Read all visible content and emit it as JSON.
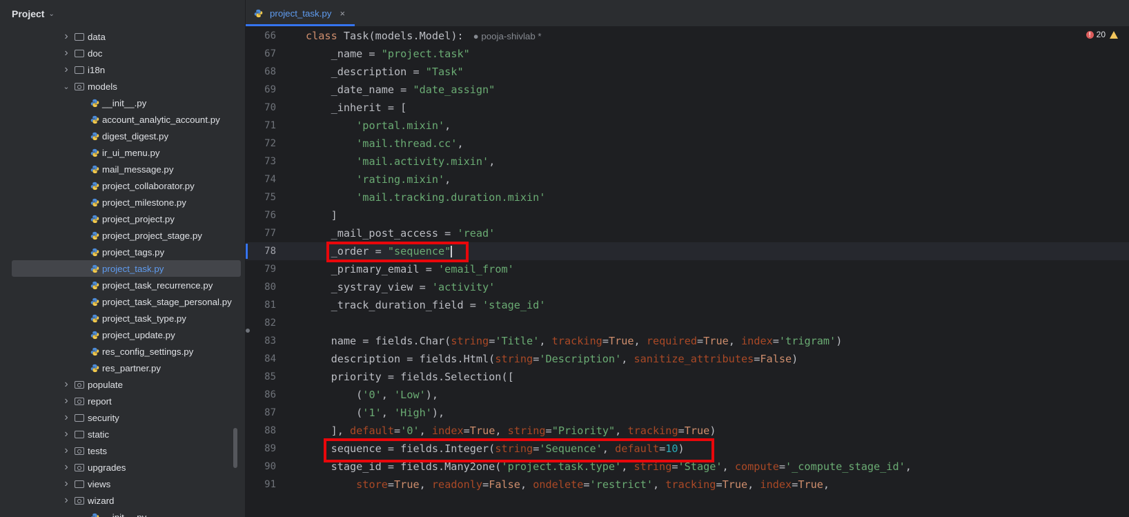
{
  "sidebar": {
    "title": "Project",
    "items": [
      {
        "label": "data",
        "type": "folder"
      },
      {
        "label": "doc",
        "type": "folder"
      },
      {
        "label": "i18n",
        "type": "folder"
      },
      {
        "label": "models",
        "type": "package",
        "expanded": true
      },
      {
        "label": "__init__.py",
        "type": "py"
      },
      {
        "label": "account_analytic_account.py",
        "type": "py"
      },
      {
        "label": "digest_digest.py",
        "type": "py"
      },
      {
        "label": "ir_ui_menu.py",
        "type": "py"
      },
      {
        "label": "mail_message.py",
        "type": "py"
      },
      {
        "label": "project_collaborator.py",
        "type": "py"
      },
      {
        "label": "project_milestone.py",
        "type": "py"
      },
      {
        "label": "project_project.py",
        "type": "py"
      },
      {
        "label": "project_project_stage.py",
        "type": "py"
      },
      {
        "label": "project_tags.py",
        "type": "py"
      },
      {
        "label": "project_task.py",
        "type": "py",
        "selected": true
      },
      {
        "label": "project_task_recurrence.py",
        "type": "py"
      },
      {
        "label": "project_task_stage_personal.py",
        "type": "py"
      },
      {
        "label": "project_task_type.py",
        "type": "py"
      },
      {
        "label": "project_update.py",
        "type": "py"
      },
      {
        "label": "res_config_settings.py",
        "type": "py"
      },
      {
        "label": "res_partner.py",
        "type": "py"
      },
      {
        "label": "populate",
        "type": "package"
      },
      {
        "label": "report",
        "type": "package"
      },
      {
        "label": "security",
        "type": "folder"
      },
      {
        "label": "static",
        "type": "folder"
      },
      {
        "label": "tests",
        "type": "package"
      },
      {
        "label": "upgrades",
        "type": "package"
      },
      {
        "label": "views",
        "type": "folder"
      },
      {
        "label": "wizard",
        "type": "package"
      },
      {
        "label": "__init__.py",
        "type": "py"
      }
    ]
  },
  "tab": {
    "label": "project_task.py",
    "close": "×"
  },
  "status": {
    "errors": "20"
  },
  "author": "pooja-shivlab *",
  "colors": {
    "accent": "#3574f0",
    "highlight": "#e8070b",
    "keyword": "#cf8e6d",
    "string": "#6aab73",
    "number": "#2aacb8",
    "param": "#aa4926"
  },
  "lines": [
    {
      "n": "66",
      "tokens": [
        [
          "kw",
          "class "
        ],
        [
          "",
          "Task(models.Model):"
        ]
      ]
    },
    {
      "n": "67",
      "tokens": [
        [
          "",
          "    _name = "
        ],
        [
          "str",
          "\"project.task\""
        ]
      ]
    },
    {
      "n": "68",
      "tokens": [
        [
          "",
          "    _description = "
        ],
        [
          "str",
          "\"Task\""
        ]
      ]
    },
    {
      "n": "69",
      "tokens": [
        [
          "",
          "    _date_name = "
        ],
        [
          "str",
          "\"date_assign\""
        ]
      ]
    },
    {
      "n": "70",
      "tokens": [
        [
          "",
          "    _inherit = ["
        ]
      ]
    },
    {
      "n": "71",
      "tokens": [
        [
          "",
          "        "
        ],
        [
          "str",
          "'portal.mixin'"
        ],
        [
          "",
          ","
        ]
      ]
    },
    {
      "n": "72",
      "tokens": [
        [
          "",
          "        "
        ],
        [
          "str",
          "'mail.thread.cc'"
        ],
        [
          "",
          ","
        ]
      ]
    },
    {
      "n": "73",
      "tokens": [
        [
          "",
          "        "
        ],
        [
          "str",
          "'mail.activity.mixin'"
        ],
        [
          "",
          ","
        ]
      ]
    },
    {
      "n": "74",
      "tokens": [
        [
          "",
          "        "
        ],
        [
          "str",
          "'rating.mixin'"
        ],
        [
          "",
          ","
        ]
      ]
    },
    {
      "n": "75",
      "tokens": [
        [
          "",
          "        "
        ],
        [
          "str",
          "'mail.tracking.duration.mixin'"
        ]
      ]
    },
    {
      "n": "76",
      "tokens": [
        [
          "",
          "    ]"
        ]
      ]
    },
    {
      "n": "77",
      "tokens": [
        [
          "",
          "    _mail_post_access = "
        ],
        [
          "str",
          "'read'"
        ]
      ]
    },
    {
      "n": "78",
      "current": true,
      "tokens": [
        [
          "",
          "    _order = "
        ],
        [
          "str",
          "\"sequence\""
        ]
      ]
    },
    {
      "n": "79",
      "tokens": [
        [
          "",
          "    _primary_email = "
        ],
        [
          "str",
          "'email_from'"
        ]
      ]
    },
    {
      "n": "80",
      "tokens": [
        [
          "",
          "    _systray_view = "
        ],
        [
          "str",
          "'activity'"
        ]
      ]
    },
    {
      "n": "81",
      "tokens": [
        [
          "",
          "    _track_duration_field = "
        ],
        [
          "str",
          "'stage_id'"
        ]
      ]
    },
    {
      "n": "82",
      "tokens": []
    },
    {
      "n": "83",
      "tokens": [
        [
          "",
          "    name = fields.Char("
        ],
        [
          "param",
          "string"
        ],
        [
          "",
          "="
        ],
        [
          "str",
          "'Title'"
        ],
        [
          "",
          ", "
        ],
        [
          "param",
          "tracking"
        ],
        [
          "",
          "="
        ],
        [
          "kw",
          "True"
        ],
        [
          "",
          ", "
        ],
        [
          "param",
          "required"
        ],
        [
          "",
          "="
        ],
        [
          "kw",
          "True"
        ],
        [
          "",
          ", "
        ],
        [
          "param",
          "index"
        ],
        [
          "",
          "="
        ],
        [
          "str",
          "'trigram'"
        ],
        [
          "",
          ")"
        ]
      ]
    },
    {
      "n": "84",
      "tokens": [
        [
          "",
          "    description = fields.Html("
        ],
        [
          "param",
          "string"
        ],
        [
          "",
          "="
        ],
        [
          "str",
          "'Description'"
        ],
        [
          "",
          ", "
        ],
        [
          "param",
          "sanitize_attributes"
        ],
        [
          "",
          "="
        ],
        [
          "kw",
          "False"
        ],
        [
          "",
          ")"
        ]
      ]
    },
    {
      "n": "85",
      "tokens": [
        [
          "",
          "    priority = fields.Selection(["
        ]
      ]
    },
    {
      "n": "86",
      "tokens": [
        [
          "",
          "        ("
        ],
        [
          "str",
          "'0'"
        ],
        [
          "",
          ", "
        ],
        [
          "str",
          "'Low'"
        ],
        [
          "",
          "),"
        ]
      ]
    },
    {
      "n": "87",
      "tokens": [
        [
          "",
          "        ("
        ],
        [
          "str",
          "'1'"
        ],
        [
          "",
          ", "
        ],
        [
          "str",
          "'High'"
        ],
        [
          "",
          "),"
        ]
      ]
    },
    {
      "n": "88",
      "tokens": [
        [
          "",
          "    ], "
        ],
        [
          "param",
          "default"
        ],
        [
          "",
          "="
        ],
        [
          "str",
          "'0'"
        ],
        [
          "",
          ", "
        ],
        [
          "param",
          "index"
        ],
        [
          "",
          "="
        ],
        [
          "kw",
          "True"
        ],
        [
          "",
          ", "
        ],
        [
          "param",
          "string"
        ],
        [
          "",
          "="
        ],
        [
          "str",
          "\"Priority\""
        ],
        [
          "",
          ", "
        ],
        [
          "param",
          "tracking"
        ],
        [
          "",
          "="
        ],
        [
          "kw",
          "True"
        ],
        [
          "",
          ")"
        ]
      ]
    },
    {
      "n": "89",
      "tokens": [
        [
          "",
          "    sequence = fields.Integer("
        ],
        [
          "param",
          "string"
        ],
        [
          "",
          "="
        ],
        [
          "str",
          "'Sequence'"
        ],
        [
          "",
          ", "
        ],
        [
          "param",
          "default"
        ],
        [
          "",
          "="
        ],
        [
          "num",
          "10"
        ],
        [
          "",
          ")"
        ]
      ]
    },
    {
      "n": "90",
      "tokens": [
        [
          "",
          "    stage_id = fields.Many2one("
        ],
        [
          "str",
          "'project.task.type'"
        ],
        [
          "",
          ", "
        ],
        [
          "param",
          "string"
        ],
        [
          "",
          "="
        ],
        [
          "str",
          "'Stage'"
        ],
        [
          "",
          ", "
        ],
        [
          "param",
          "compute"
        ],
        [
          "",
          "="
        ],
        [
          "str",
          "'_compute_stage_id'"
        ],
        [
          "",
          ","
        ]
      ]
    },
    {
      "n": "91",
      "tokens": [
        [
          "",
          "        "
        ],
        [
          "param",
          "store"
        ],
        [
          "",
          "="
        ],
        [
          "kw",
          "True"
        ],
        [
          "",
          ", "
        ],
        [
          "param",
          "readonly"
        ],
        [
          "",
          "="
        ],
        [
          "kw",
          "False"
        ],
        [
          "",
          ", "
        ],
        [
          "param",
          "ondelete"
        ],
        [
          "",
          "="
        ],
        [
          "str",
          "'restrict'"
        ],
        [
          "",
          ", "
        ],
        [
          "param",
          "tracking"
        ],
        [
          "",
          "="
        ],
        [
          "kw",
          "True"
        ],
        [
          "",
          ", "
        ],
        [
          "param",
          "index"
        ],
        [
          "",
          "="
        ],
        [
          "kw",
          "True"
        ],
        [
          "",
          ","
        ]
      ]
    }
  ]
}
